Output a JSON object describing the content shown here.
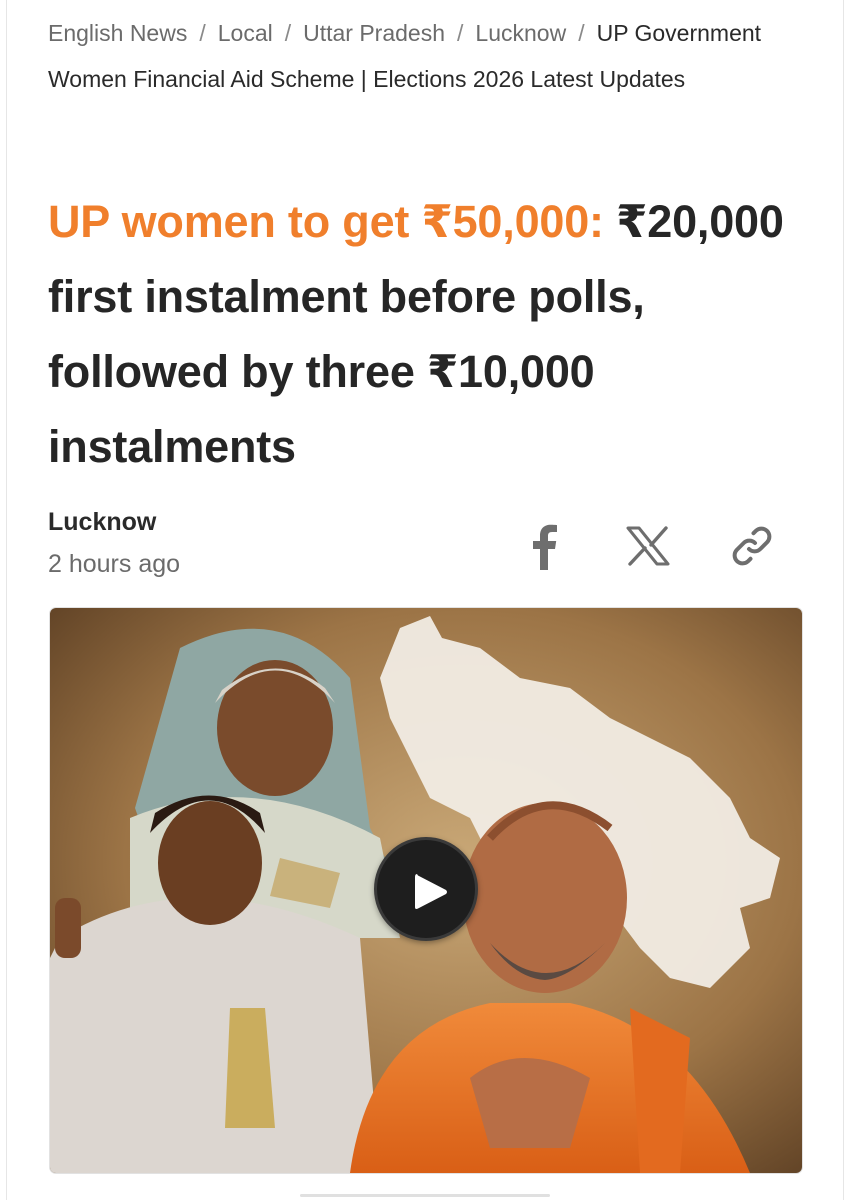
{
  "breadcrumb": {
    "items": [
      "English News",
      "Local",
      "Uttar Pradesh",
      "Lucknow"
    ],
    "separator": "/",
    "current": "UP Government Women Financial Aid Scheme | Elections 2026 Latest Updates"
  },
  "article": {
    "headline_accent": "UP women to get ₹50,000:",
    "headline_rest": "₹20,000 first instalment before polls, followed by three ₹10,000 instalments",
    "location": "Lucknow",
    "time_ago": "2 hours ago"
  },
  "share": {
    "icons": [
      "facebook-icon",
      "x-icon",
      "link-icon"
    ]
  },
  "media": {
    "type": "video",
    "icon": "play-icon"
  },
  "colors": {
    "accent": "#f07f2c",
    "text": "#262626",
    "muted": "#6b6b6b"
  }
}
